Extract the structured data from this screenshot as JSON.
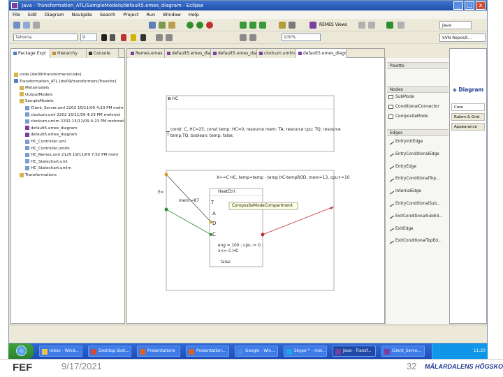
{
  "window": {
    "title": "Java - Transformation_ATL/SampleModels/default5.emes_diagram - Eclipse",
    "min": "_",
    "max": "□",
    "close": "x"
  },
  "menu": [
    "File",
    "Edit",
    "Diagram",
    "Navigate",
    "Search",
    "Project",
    "Run",
    "Window",
    "Help"
  ],
  "toolbar": {
    "font_combo": "Tahoma",
    "size_combo": "9",
    "zoom_combo": "100%",
    "run_label": "REMES Views"
  },
  "perspectives": {
    "java": "Java",
    "svn": "SVN Reposit..."
  },
  "left_tabs": [
    "Package Expl",
    "Hierarchy",
    "Console"
  ],
  "tree": [
    {
      "label": "code [dsi09/transformers/code]",
      "indent": 0,
      "color": "folder"
    },
    {
      "label": "Transformation_ATL [dsi09/transformers/Transfor]",
      "indent": 0,
      "color": "project"
    },
    {
      "label": "Metamodels",
      "indent": 1,
      "color": "folder"
    },
    {
      "label": "OutputModels",
      "indent": 1,
      "color": "folder"
    },
    {
      "label": "SampleModels",
      "indent": 1,
      "color": "folder"
    },
    {
      "label": "Client_Server.uml 2202  15/11/09 4:23 PM  mehr",
      "indent": 2,
      "color": "file"
    },
    {
      "label": "clockum.uml 2202  15/11/09 4:23 PM  mehmet",
      "indent": 2,
      "color": "file"
    },
    {
      "label": "clockum.umlm 2202  15/11/09 4:23 PM  mehmet",
      "indent": 2,
      "color": "file"
    },
    {
      "label": "default5.emes_diagram",
      "indent": 2,
      "color": "diagram"
    },
    {
      "label": "default5.emes_diagram",
      "indent": 2,
      "color": "diagram"
    },
    {
      "label": "HC_Controller.uml",
      "indent": 2,
      "color": "file"
    },
    {
      "label": "HC_Controller.umlm",
      "indent": 2,
      "color": "file"
    },
    {
      "label": "HC_Remes.uml 2129  19/11/09 7:52 PM  mehr",
      "indent": 2,
      "color": "file"
    },
    {
      "label": "HC_Statechart.uml",
      "indent": 2,
      "color": "file"
    },
    {
      "label": "HC_Statechart.umlm",
      "indent": 2,
      "color": "file"
    },
    {
      "label": "Transformations",
      "indent": 1,
      "color": "folder"
    }
  ],
  "editor_tabs": [
    "Remes.emes",
    "default5.emes_diag",
    "default5.emes_diagr",
    "clockum.umlm",
    "default5.emes_diagr"
  ],
  "palette": {
    "title": "Palette",
    "nodes_header": "Nodes",
    "nodes": [
      "SubMode",
      "ConditionalConnector",
      "CompositeMode"
    ],
    "edges_header": "Edges",
    "edges": [
      "EntryInitEdge",
      "EntryConditionalEdge",
      "EntryEdge",
      "EntryConditionalTop...",
      "InternalEdge",
      "EntryConditionalSub...",
      "ExitConditionalSubEd...",
      "ExitEdge",
      "ExitConditionalTopEd..."
    ]
  },
  "properties": {
    "title": "Diagram",
    "tabs": [
      "Core",
      "Rulers & Grid",
      "Appearance"
    ]
  },
  "diagram": {
    "top_title": "HC",
    "top_declarations": "const: C, HC=25; const temp: HC=0; resource mem: TA; resource cpu: TQ; resource",
    "top_declarations2": "temp:TQ; boolean: temp: false;",
    "left_t": "T",
    "entry_label": "mem:=87",
    "guard_text": "X==C HC, temp=temp - temp HC-tempROD, mem=13, cpu+=10",
    "inner_title": "HeatCtrl",
    "tooltip": "CompositeModeCompartment",
    "inner_rows": [
      "T",
      "A",
      "D",
      "C"
    ],
    "inv_text": "eng = 100 ; cpu := 0 ;",
    "inv_text2": "x<= C HC",
    "false_text": "false",
    "left_marker": "E="
  },
  "taskbar": {
    "tasks": [
      "Inbox - Wind...",
      "Desktop Sket...",
      "Presentations",
      "Presentation...",
      "Google - Win...",
      "Skype™ - mel...",
      "Java - Transf...",
      "Client_Serve..."
    ],
    "tray_time": "11:20"
  },
  "footer": {
    "date": "9/17/2021",
    "page_num": "32",
    "logo_left": "FEF",
    "logo_right": "MÄLARDALENS HÖGSKOLA"
  },
  "colors": {
    "window_frame": "#7a96b6",
    "title_bar": "#2a5fbe",
    "taskbar": "#2659cb",
    "edge_red": "#c03030",
    "edge_green": "#2f8f2f",
    "footer_blue": "#1d3a8f"
  }
}
